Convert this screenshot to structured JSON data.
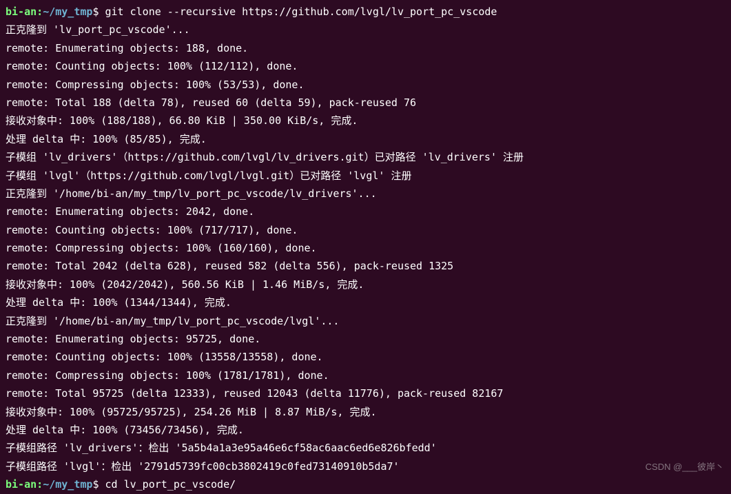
{
  "prompt1": {
    "user": "bi-an:",
    "path": "~/my_tmp",
    "dollar": "$ ",
    "cmd": "git clone --recursive https://github.com/lvgl/lv_port_pc_vscode"
  },
  "lines": [
    "正克隆到 'lv_port_pc_vscode'...",
    "remote: Enumerating objects: 188, done.",
    "remote: Counting objects: 100% (112/112), done.",
    "remote: Compressing objects: 100% (53/53), done.",
    "remote: Total 188 (delta 78), reused 60 (delta 59), pack-reused 76",
    "接收对象中: 100% (188/188), 66.80 KiB | 350.00 KiB/s, 完成.",
    "处理 delta 中: 100% (85/85), 完成.",
    "子模组 'lv_drivers'（https://github.com/lvgl/lv_drivers.git）已对路径 'lv_drivers' 注册",
    "子模组 'lvgl'（https://github.com/lvgl/lvgl.git）已对路径 'lvgl' 注册",
    "正克隆到 '/home/bi-an/my_tmp/lv_port_pc_vscode/lv_drivers'...",
    "remote: Enumerating objects: 2042, done.",
    "remote: Counting objects: 100% (717/717), done.",
    "remote: Compressing objects: 100% (160/160), done.",
    "remote: Total 2042 (delta 628), reused 582 (delta 556), pack-reused 1325",
    "接收对象中: 100% (2042/2042), 560.56 KiB | 1.46 MiB/s, 完成.",
    "处理 delta 中: 100% (1344/1344), 完成.",
    "正克隆到 '/home/bi-an/my_tmp/lv_port_pc_vscode/lvgl'...",
    "remote: Enumerating objects: 95725, done.",
    "remote: Counting objects: 100% (13558/13558), done.",
    "remote: Compressing objects: 100% (1781/1781), done.",
    "remote: Total 95725 (delta 12333), reused 12043 (delta 11776), pack-reused 82167",
    "接收对象中: 100% (95725/95725), 254.26 MiB | 8.87 MiB/s, 完成.",
    "处理 delta 中: 100% (73456/73456), 完成.",
    "子模组路径 'lv_drivers'：检出 '5a5b4a1a3e95a46e6cf58ac6aac6ed6e826bfedd'",
    "子模组路径 'lvgl'：检出 '2791d5739fc00cb3802419c0fed73140910b5da7'"
  ],
  "prompt2": {
    "user": "bi-an:",
    "path": "~/my_tmp",
    "dollar": "$ ",
    "cmd": "cd lv_port_pc_vscode/"
  },
  "watermark": "CSDN @___彼岸丶"
}
